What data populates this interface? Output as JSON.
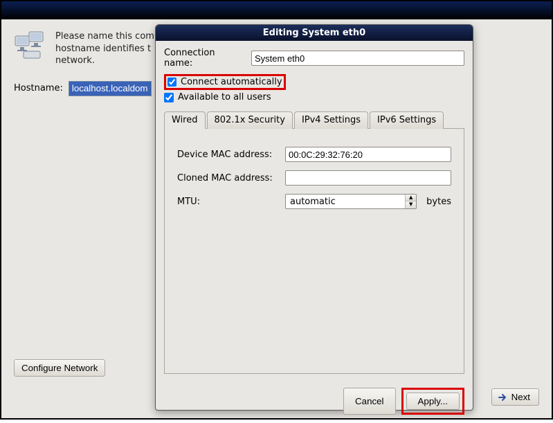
{
  "background": {
    "intro_line1": "Please name this com",
    "intro_line2": "hostname identifies t",
    "intro_line3": "network.",
    "hostname_label": "Hostname:",
    "hostname_value": "localhost.localdoma",
    "configure_network_label": "Configure Network",
    "next_label": "Next"
  },
  "dialog": {
    "title": "Editing System eth0",
    "connection_name_label": "Connection name:",
    "connection_name_value": "System eth0",
    "connect_automatically_label": "Connect automatically",
    "connect_automatically_checked": true,
    "available_all_users_label": "Available to all users",
    "available_all_users_checked": true,
    "tabs": {
      "wired": "Wired",
      "security": "802.1x Security",
      "ipv4": "IPv4 Settings",
      "ipv6": "IPv6 Settings",
      "active": "wired"
    },
    "wired_panel": {
      "device_mac_label": "Device MAC address:",
      "device_mac_value": "00:0C:29:32:76:20",
      "cloned_mac_label": "Cloned MAC address:",
      "cloned_mac_value": "",
      "mtu_label": "MTU:",
      "mtu_value": "automatic",
      "mtu_unit": "bytes"
    },
    "buttons": {
      "cancel": "Cancel",
      "apply": "Apply..."
    }
  }
}
